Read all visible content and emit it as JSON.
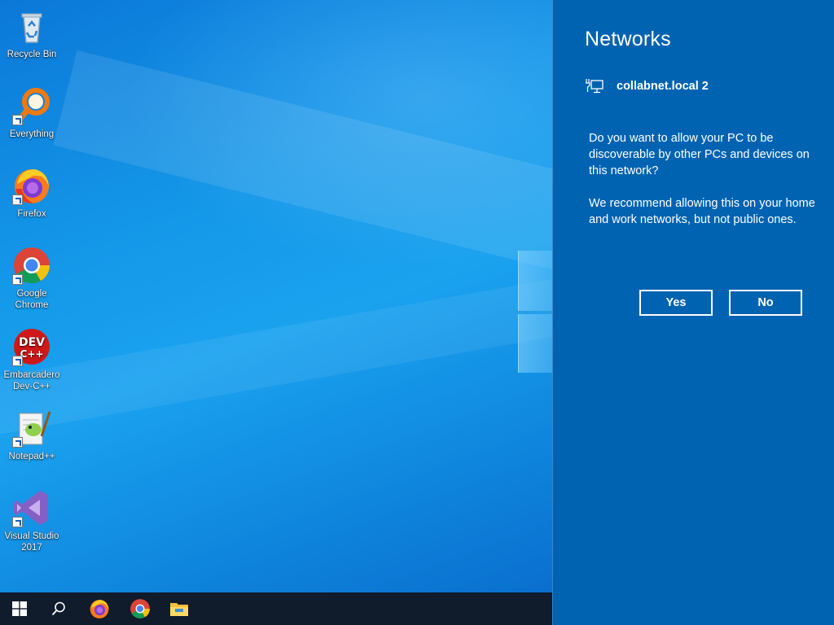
{
  "desktop": {
    "icons": [
      {
        "label": "Recycle Bin",
        "icon": "recycle-bin-icon"
      },
      {
        "label": "Everything",
        "icon": "everything-search-icon"
      },
      {
        "label": "Firefox",
        "icon": "firefox-icon"
      },
      {
        "label": "Google Chrome",
        "icon": "chrome-icon"
      },
      {
        "label": "Embarcadero Dev-C++",
        "icon": "devcpp-icon"
      },
      {
        "label": "Notepad++",
        "icon": "notepadpp-icon"
      },
      {
        "label": "Visual Studio 2017",
        "icon": "visual-studio-icon"
      }
    ]
  },
  "taskbar": {
    "items": [
      {
        "icon": "windows-start-icon"
      },
      {
        "icon": "search-icon"
      },
      {
        "icon": "firefox-icon"
      },
      {
        "icon": "chrome-icon"
      },
      {
        "icon": "file-explorer-icon"
      }
    ]
  },
  "panel": {
    "title": "Networks",
    "network": {
      "icon": "ethernet-monitor-icon",
      "name": "collabnet.local 2"
    },
    "question": "Do you want to allow your PC to be discoverable by other PCs and devices on this network?",
    "recommendation": "We recommend allowing this on your home and work networks, but not public ones.",
    "yes_label": "Yes",
    "no_label": "No"
  },
  "colors": {
    "panel_bg": "#0063b1",
    "taskbar_bg": "#101c2c",
    "desktop_blue": "#1497e8"
  }
}
